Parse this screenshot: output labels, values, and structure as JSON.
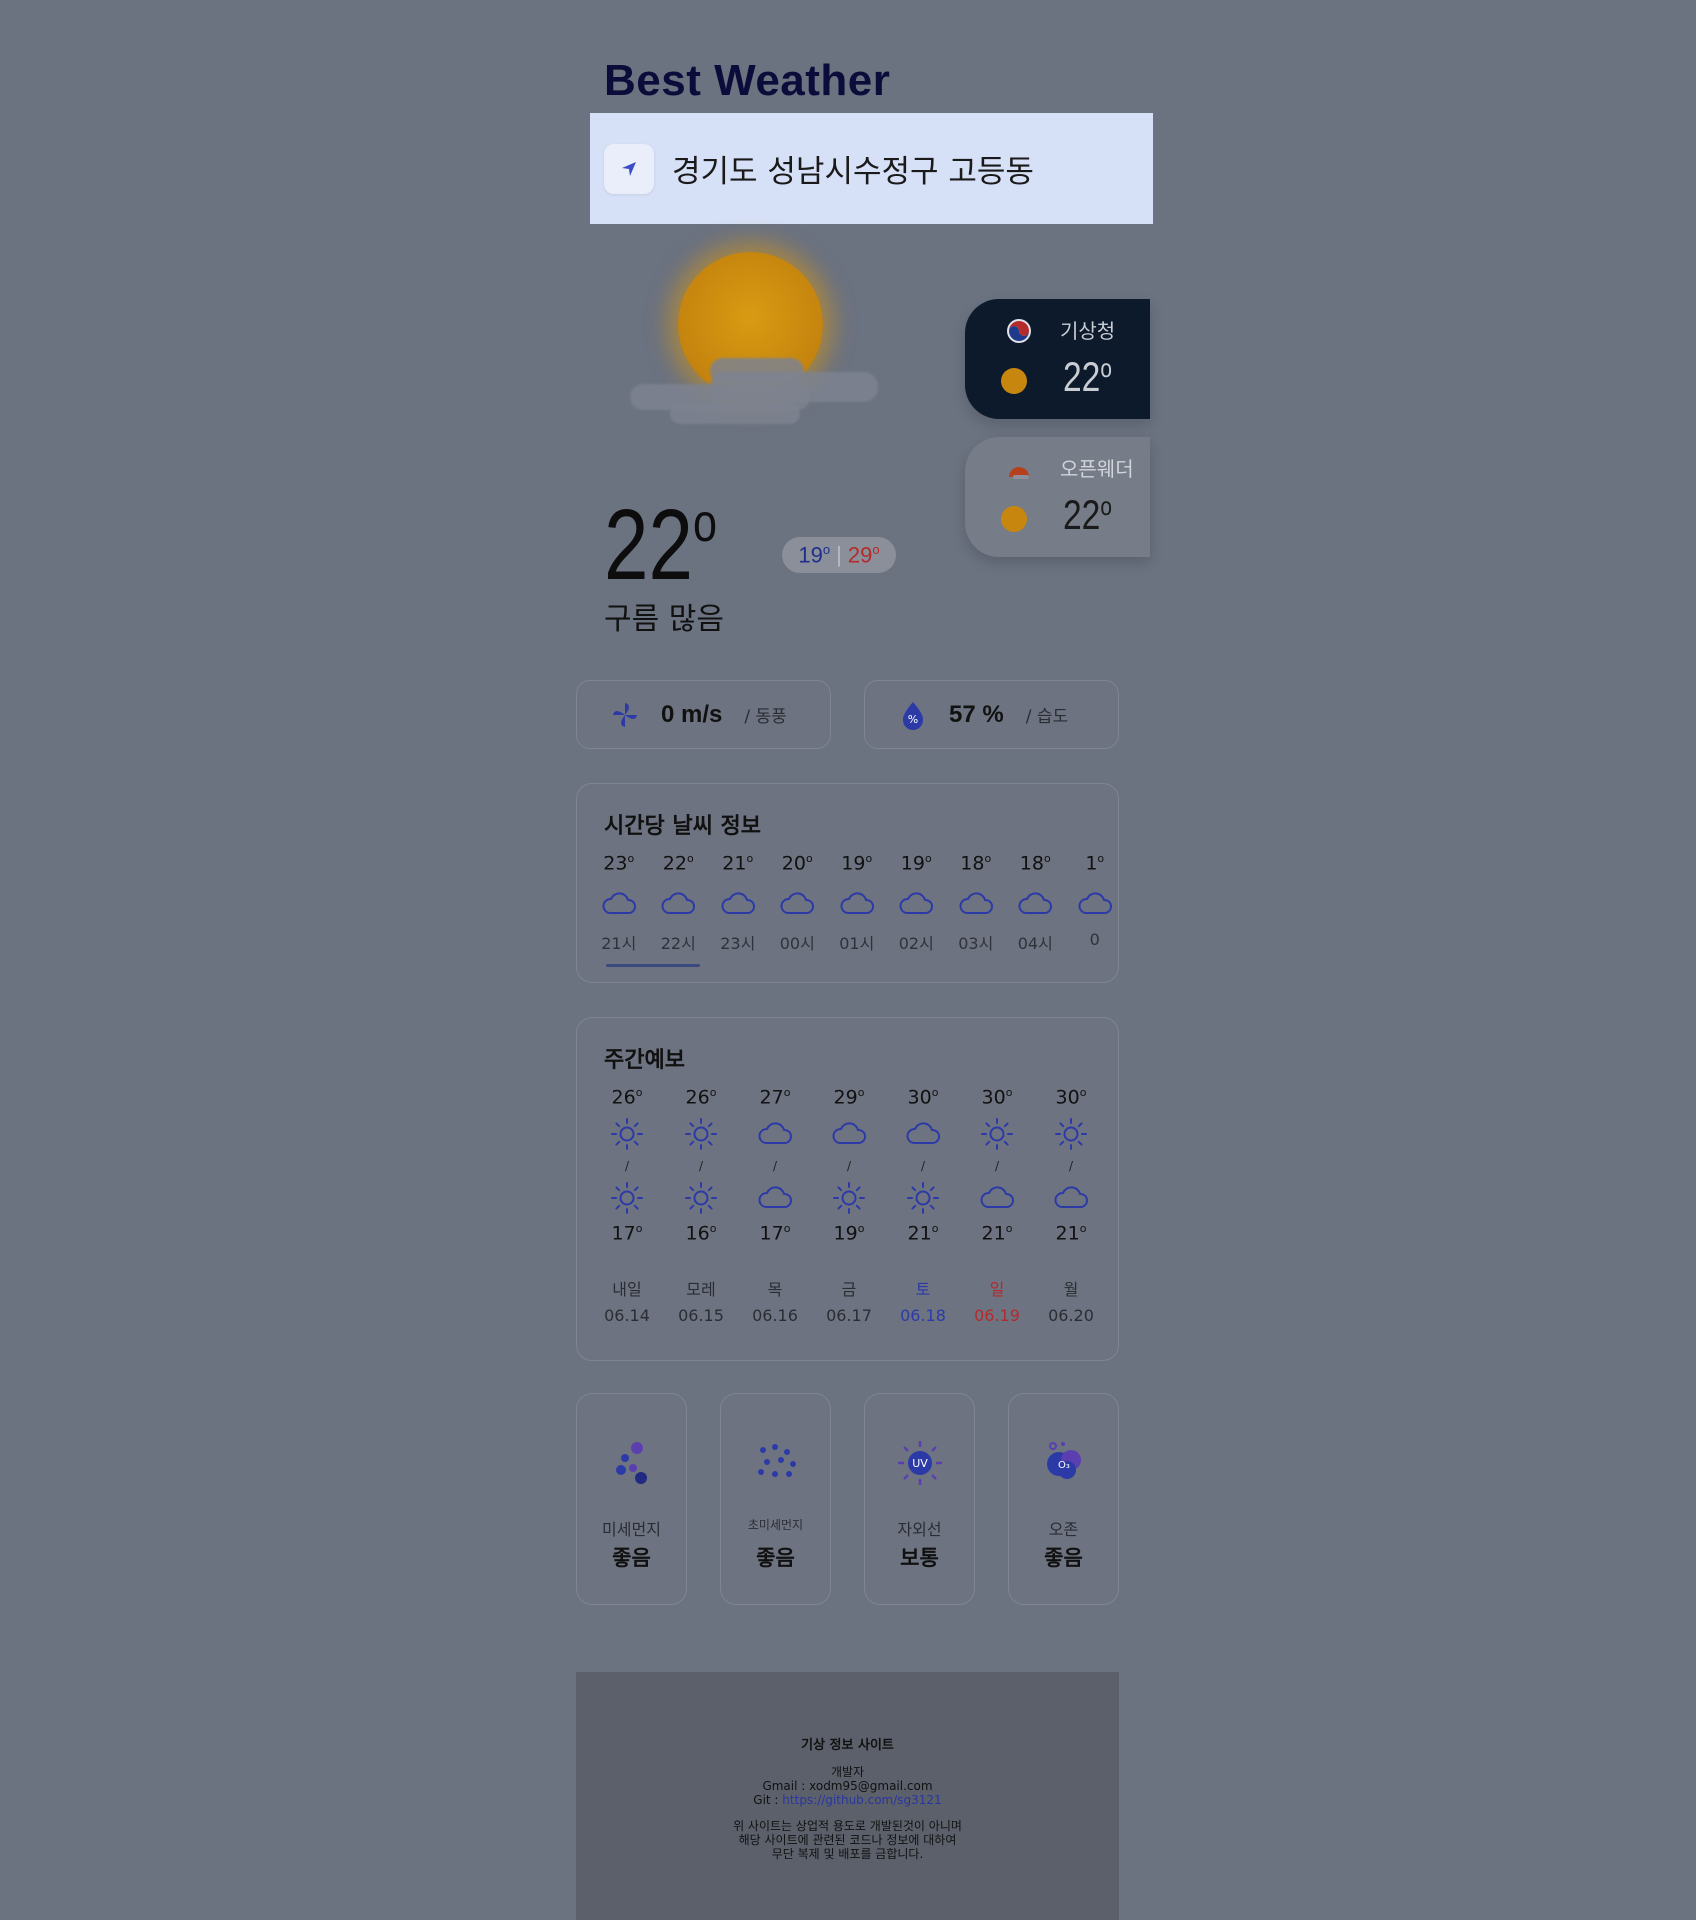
{
  "app": {
    "title": "Best Weather"
  },
  "location": {
    "text": "경기도 성남시수정구 고등동"
  },
  "current": {
    "temp": "22",
    "desc": "구름 많음",
    "min": "19",
    "max": "29"
  },
  "sources": [
    {
      "name": "기상청",
      "temp": "22"
    },
    {
      "name": "오픈웨더",
      "temp": "22"
    }
  ],
  "wind": {
    "value": "0 m/s",
    "label": "/ 동풍"
  },
  "humidity": {
    "value": "57 %",
    "label": "/ 습도"
  },
  "hourly": {
    "title": "시간당 날씨 정보",
    "items": [
      {
        "temp": "23",
        "time": "21시",
        "icon": "cloud-icon"
      },
      {
        "temp": "22",
        "time": "22시",
        "icon": "cloud-icon"
      },
      {
        "temp": "21",
        "time": "23시",
        "icon": "cloud-icon"
      },
      {
        "temp": "20",
        "time": "00시",
        "icon": "cloud-icon"
      },
      {
        "temp": "19",
        "time": "01시",
        "icon": "cloud-icon"
      },
      {
        "temp": "19",
        "time": "02시",
        "icon": "cloud-icon"
      },
      {
        "temp": "18",
        "time": "03시",
        "icon": "cloud-icon"
      },
      {
        "temp": "18",
        "time": "04시",
        "icon": "cloud-icon"
      },
      {
        "temp": "1",
        "time": "0",
        "icon": "cloud-icon"
      }
    ]
  },
  "weekly": {
    "title": "주간예보",
    "items": [
      {
        "high": "26",
        "low": "17",
        "am": "sun",
        "pm": "sun",
        "day": "내일",
        "date": "06.14",
        "tone": ""
      },
      {
        "high": "26",
        "low": "16",
        "am": "sun",
        "pm": "sun",
        "day": "모레",
        "date": "06.15",
        "tone": ""
      },
      {
        "high": "27",
        "low": "17",
        "am": "cloud",
        "pm": "cloud",
        "day": "목",
        "date": "06.16",
        "tone": ""
      },
      {
        "high": "29",
        "low": "19",
        "am": "cloud",
        "pm": "sun",
        "day": "금",
        "date": "06.17",
        "tone": ""
      },
      {
        "high": "30",
        "low": "21",
        "am": "cloud",
        "pm": "sun",
        "day": "토",
        "date": "06.18",
        "tone": "blue"
      },
      {
        "high": "30",
        "low": "21",
        "am": "sun",
        "pm": "cloud",
        "day": "일",
        "date": "06.19",
        "tone": "red"
      },
      {
        "high": "30",
        "low": "21",
        "am": "sun",
        "pm": "cloud",
        "day": "월",
        "date": "06.20",
        "tone": ""
      }
    ]
  },
  "air": [
    {
      "label": "미세먼지",
      "value": "좋음",
      "icon": "fine-dust-icon"
    },
    {
      "label": "초미세먼지",
      "value": "좋음",
      "icon": "ultrafine-dust-icon"
    },
    {
      "label": "자외선",
      "value": "보통",
      "icon": "uv-icon"
    },
    {
      "label": "오존",
      "value": "좋음",
      "icon": "ozone-icon"
    }
  ],
  "footer": {
    "title": "기상 정보 사이트",
    "developer": "개발자",
    "gmail": "Gmail : xodm95@gmail.com",
    "git_label": "Git : ",
    "git_url": "https://github.com/sg3121",
    "notice1": "위 사이트는 상업적 용도로 개발된것이 아니며",
    "notice2": "해당 사이트에 관련된 코드나 정보에 대하여",
    "notice3": "무단 복제 및 배포를 금합니다."
  },
  "colors": {
    "accent": "#2c3aa8",
    "warm": "#b52a2a",
    "sun": "#c7870f"
  }
}
